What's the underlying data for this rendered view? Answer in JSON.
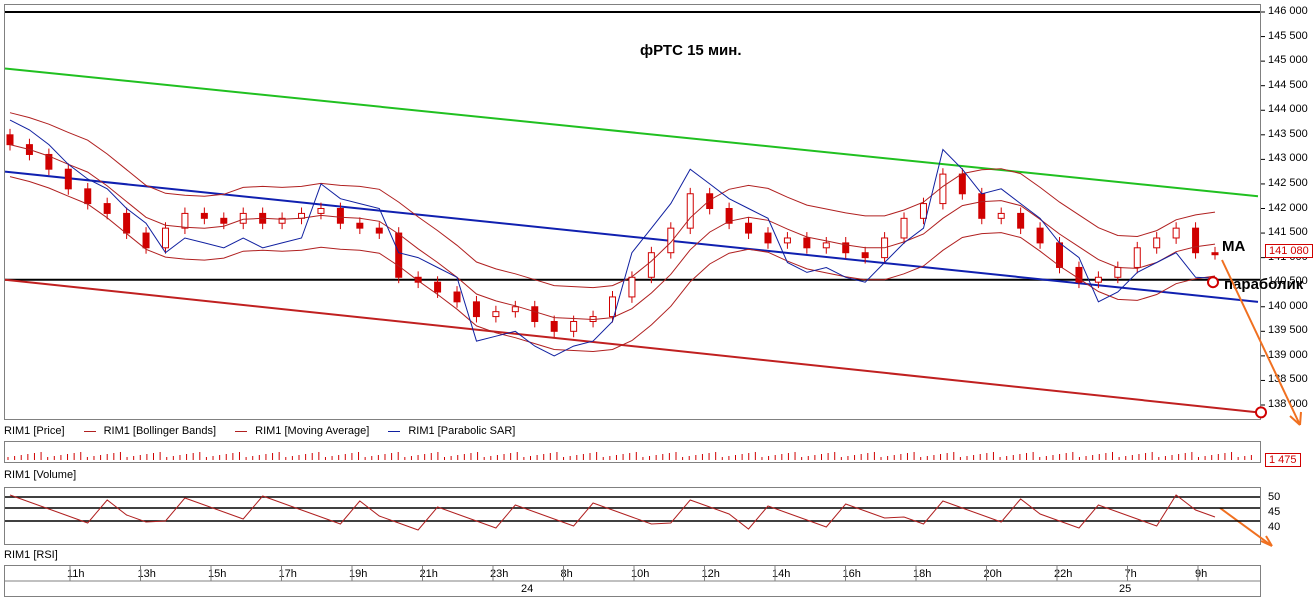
{
  "title": "фРТС   15 мин.",
  "legend_price": [
    "RIM1 [Price]",
    "RIM1 [Bollinger Bands]",
    "RIM1 [Moving Average]",
    "RIM1 [Parabolic SAR]"
  ],
  "legend_volume": "RIM1 [Volume]",
  "legend_rsi": "RIM1 [RSI]",
  "last_price_label": "141 080",
  "last_volume_label": "1 475",
  "annotations": {
    "ma": "MA",
    "parabolic": "параболик"
  },
  "colors": {
    "candle": "#d00000",
    "boll": "#b02020",
    "ma": "#b02020",
    "sar": "#1020a0",
    "green_line": "#20c020",
    "blue_line": "#1020b0",
    "red_line": "#c02020",
    "arrow": "#f07020"
  },
  "chart_data": {
    "type": "candlestick",
    "y_axis_ticks": [
      "146 000",
      "145 500",
      "145 000",
      "144 500",
      "144 000",
      "143 500",
      "143 000",
      "142 500",
      "142 000",
      "141 500",
      "141 000",
      "140 500",
      "140 000",
      "139 500",
      "139 000",
      "138 500",
      "138 000"
    ],
    "y_range": [
      137700,
      146200
    ],
    "x_time_labels": [
      "11h",
      "13h",
      "15h",
      "17h",
      "19h",
      "21h",
      "23h",
      "8h",
      "10h",
      "12h",
      "14h",
      "16h",
      "18h",
      "20h",
      "22h",
      "7h",
      "9h"
    ],
    "date_labels": [
      "24",
      "25"
    ],
    "close_series": [
      143300,
      143100,
      142800,
      142400,
      142100,
      141900,
      141500,
      141200,
      141600,
      141900,
      141800,
      141700,
      141900,
      141700,
      141800,
      141900,
      142000,
      141700,
      141600,
      141500,
      140600,
      140500,
      140300,
      140100,
      139800,
      139900,
      140000,
      139700,
      139500,
      139700,
      139800,
      140200,
      140600,
      141100,
      141600,
      142300,
      142000,
      141700,
      141500,
      141300,
      141400,
      141200,
      141300,
      141100,
      141000,
      141400,
      141800,
      142100,
      142700,
      142300,
      141800,
      141900,
      141600,
      141300,
      140800,
      140500,
      140600,
      140800,
      141200,
      141400,
      141600,
      141100,
      141080
    ],
    "horizontal_levels": [
      146000,
      140550
    ],
    "rsi_levels": [
      "50",
      "45",
      "40"
    ]
  }
}
